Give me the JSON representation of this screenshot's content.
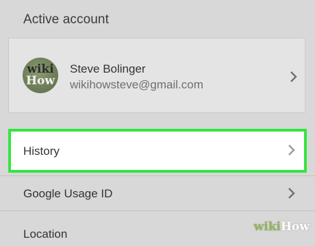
{
  "section": {
    "header": "Active account"
  },
  "account": {
    "avatar_text_top": "wiki",
    "avatar_text_bottom": "How",
    "name": "Steve Bolinger",
    "email": "wikihowsteve@gmail.com",
    "chevron_icon": "chevron-right-icon"
  },
  "rows": [
    {
      "label": "History",
      "highlighted": true,
      "highlight_color": "#33e63d"
    },
    {
      "label": "Google Usage ID"
    },
    {
      "label": "Location"
    }
  ],
  "watermark": {
    "part1": "wiki",
    "part2": "How"
  }
}
